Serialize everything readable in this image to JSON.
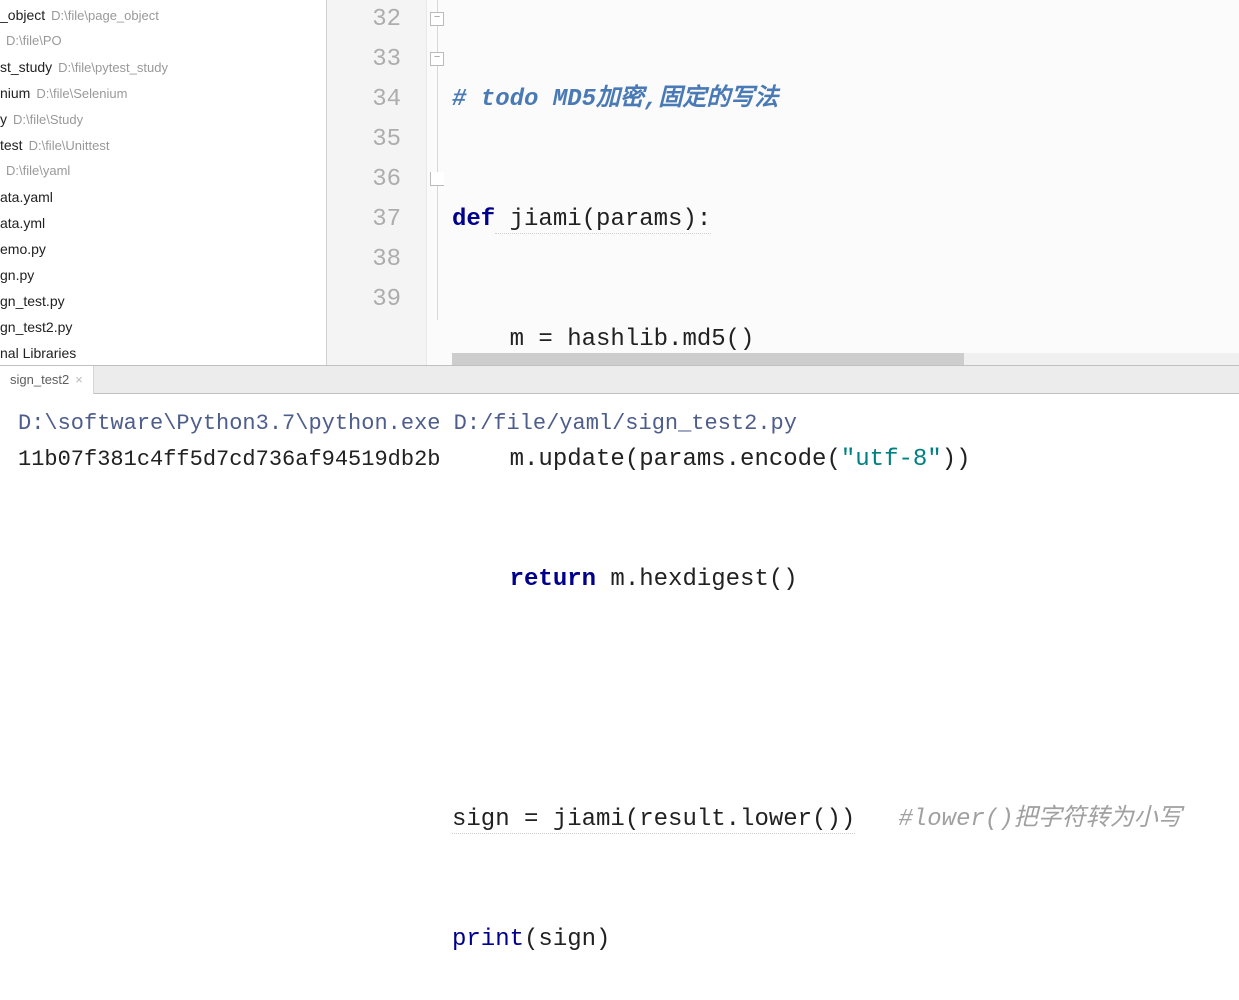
{
  "sidebar": {
    "items": [
      {
        "name": "_object",
        "path": "D:\\file\\page_object"
      },
      {
        "name": "",
        "path": "D:\\file\\PO"
      },
      {
        "name": "st_study",
        "path": "D:\\file\\pytest_study"
      },
      {
        "name": "nium",
        "path": "D:\\file\\Selenium"
      },
      {
        "name": "y",
        "path": "D:\\file\\Study"
      },
      {
        "name": "test",
        "path": "D:\\file\\Unittest"
      },
      {
        "name": "",
        "path": "D:\\file\\yaml"
      },
      {
        "name": "ata.yaml",
        "path": ""
      },
      {
        "name": "ata.yml",
        "path": ""
      },
      {
        "name": "emo.py",
        "path": ""
      },
      {
        "name": "gn.py",
        "path": ""
      },
      {
        "name": "gn_test.py",
        "path": ""
      },
      {
        "name": "gn_test2.py",
        "path": ""
      },
      {
        "name": "nal Libraries",
        "path": ""
      }
    ]
  },
  "editor": {
    "line_numbers": [
      "32",
      "33",
      "34",
      "35",
      "36",
      "37",
      "38",
      "39"
    ],
    "lines": {
      "l32": "# todo MD5加密,固定的写法",
      "l33_def": "def",
      "l33_name": " jiami(params):",
      "l34": "    m = hashlib.md5()",
      "l35_a": "    m.update(params.encode(",
      "l35_str": "\"utf-8\"",
      "l35_b": "))",
      "l36_ret": "    return",
      "l36_b": " m.hexdigest()",
      "l37": "",
      "l38_a": "sign = jiami(result.lower())",
      "l38_c": "   #lower()把字符转为小写",
      "l39_a": "print",
      "l39_b": "(sign)"
    }
  },
  "terminal": {
    "tab": "sign_test2",
    "cmd": "D:\\software\\Python3.7\\python.exe D:/file/yaml/sign_test2.py",
    "output": "11b07f381c4ff5d7cd736af94519db2b"
  }
}
